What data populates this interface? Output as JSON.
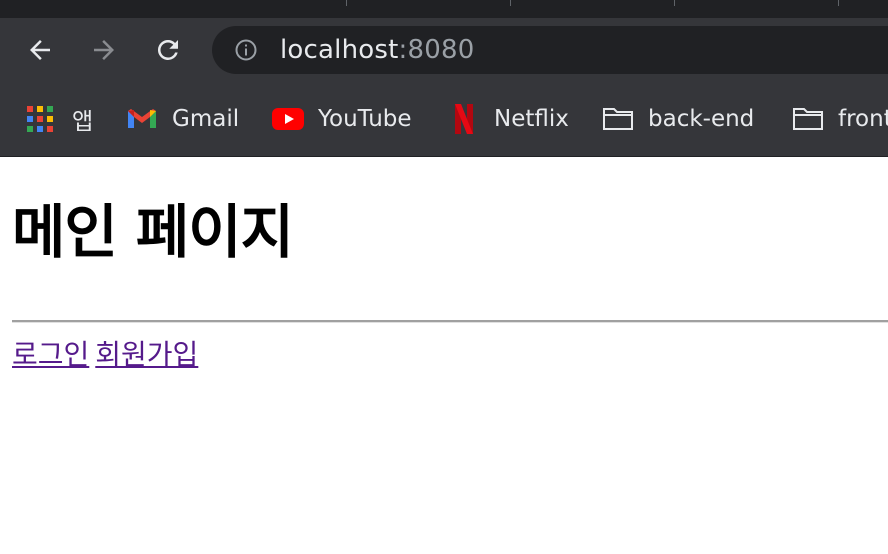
{
  "browser": {
    "address": {
      "host": "localhost",
      "port": ":8080"
    },
    "bookmarks": [
      {
        "label": "앱",
        "icon": "apps-grid-icon"
      },
      {
        "label": "Gmail",
        "icon": "gmail-icon"
      },
      {
        "label": "YouTube",
        "icon": "youtube-icon"
      },
      {
        "label": "Netflix",
        "icon": "netflix-icon"
      },
      {
        "label": "back-end",
        "icon": "folder-icon"
      },
      {
        "label": "front",
        "icon": "folder-icon"
      }
    ],
    "colors": {
      "chrome": "#35363a",
      "tabstrip": "#202124",
      "omnibox": "#202124",
      "text": "#e8eaed"
    }
  },
  "page": {
    "title": "메인 페이지",
    "links": [
      {
        "label": "로그인"
      },
      {
        "label": "회원가입"
      }
    ],
    "colors": {
      "visited_link": "#551a8b"
    }
  }
}
